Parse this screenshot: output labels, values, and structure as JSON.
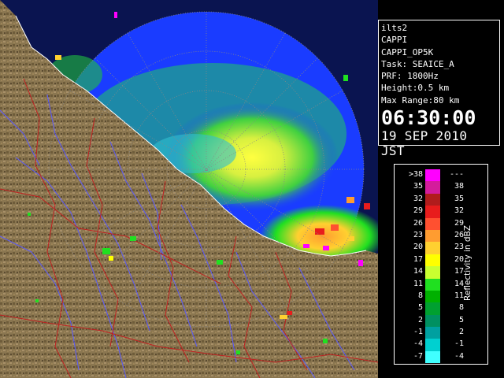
{
  "info_panel": {
    "lines": [
      "ilts2",
      "CAPPI",
      "CAPPI_OP5K",
      "Task: SEAICE_A",
      "PRF: 1800Hz",
      "Height:0.5 km",
      "Max Range:80 km"
    ],
    "time": "06:30:00",
    "date": "19 SEP 2010 JST"
  },
  "legend": {
    "unit_label": "Reflectivity in dBZ",
    "rows": [
      {
        "low": ">38",
        "high": "---",
        "color": "#ff00ff"
      },
      {
        "low": "35",
        "high": "38",
        "color": "#d41c9c"
      },
      {
        "low": "32",
        "high": "35",
        "color": "#b01c1c"
      },
      {
        "low": "29",
        "high": "32",
        "color": "#e81c1c"
      },
      {
        "low": "26",
        "high": "29",
        "color": "#ff5030"
      },
      {
        "low": "23",
        "high": "26",
        "color": "#ff9c30"
      },
      {
        "low": "20",
        "high": "23",
        "color": "#ffd030"
      },
      {
        "low": "17",
        "high": "20",
        "color": "#ffff00"
      },
      {
        "low": "14",
        "high": "17",
        "color": "#c8ff30"
      },
      {
        "low": "11",
        "high": "14",
        "color": "#20e020"
      },
      {
        "low": "8",
        "high": "11",
        "color": "#00b000"
      },
      {
        "low": "5",
        "high": "8",
        "color": "#00a030"
      },
      {
        "low": "2",
        "high": "5",
        "color": "#009060"
      },
      {
        "low": "-1",
        "high": "2",
        "color": "#00a0a0"
      },
      {
        "low": "-4",
        "high": "-1",
        "color": "#00d0d0"
      },
      {
        "low": "-7",
        "high": "-4",
        "color": "#40ffff"
      }
    ]
  },
  "colors": {
    "ocean_coverage": "#1a3cff",
    "ocean_dark": "#0a1450",
    "land": "#8a7650",
    "rivers": "#5a5aff",
    "boundaries": "#c02020"
  }
}
